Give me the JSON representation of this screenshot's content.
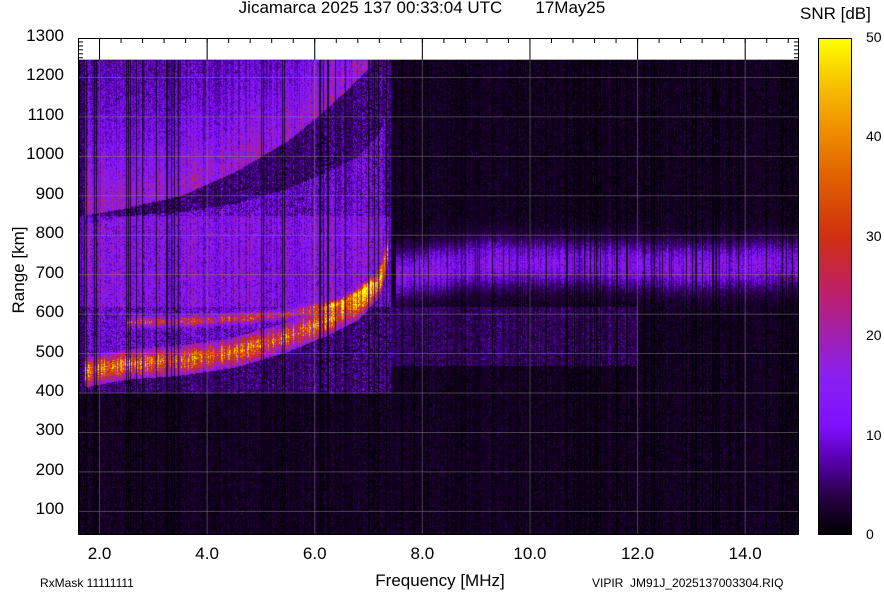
{
  "title": "Jicamarca 2025 137 00:33:04 UTC",
  "date": "17May25",
  "footer": {
    "rxmask": "RxMask 11111111",
    "file": "VIPIR  JM91J_2025137003304.RIQ"
  },
  "chart_data": {
    "type": "heatmap",
    "title": "Jicamarca 2025 137 00:33:04 UTC    17May25",
    "xlabel": "Frequency [MHz]",
    "ylabel": "Range [km]",
    "xlim": [
      1.6,
      15.0
    ],
    "ylim": [
      40,
      1300
    ],
    "xticks": [
      "2.0",
      "4.0",
      "6.0",
      "8.0",
      "10.0",
      "12.0",
      "14.0"
    ],
    "xtick_values": [
      2,
      4,
      6,
      8,
      10,
      12,
      14
    ],
    "yticks": [
      "100",
      "200",
      "300",
      "400",
      "500",
      "600",
      "700",
      "800",
      "900",
      "1000",
      "1100",
      "1200",
      "1300"
    ],
    "ytick_values": [
      100,
      200,
      300,
      400,
      500,
      600,
      700,
      800,
      900,
      1000,
      1100,
      1200,
      1300
    ],
    "grid": true,
    "colorbar": {
      "label": "SNR [dB]",
      "range": [
        0,
        50
      ],
      "ticks": [
        "0",
        "10",
        "20",
        "30",
        "40",
        "50"
      ],
      "tick_values": [
        0,
        10,
        20,
        30,
        40,
        50
      ]
    },
    "data_top_km": 1245,
    "traces": [
      {
        "name": "F-layer trace",
        "snr": 33,
        "width_km": 35,
        "points": [
          [
            1.7,
            450
          ],
          [
            2.5,
            470
          ],
          [
            3.5,
            480
          ],
          [
            4.5,
            500
          ],
          [
            5.5,
            540
          ],
          [
            6.2,
            580
          ],
          [
            6.8,
            620
          ],
          [
            7.2,
            680
          ],
          [
            7.35,
            760
          ]
        ]
      },
      {
        "name": "Upper trace",
        "snr": 24,
        "width_km": 12,
        "points": [
          [
            2.5,
            580
          ],
          [
            4,
            585
          ],
          [
            5.5,
            600
          ],
          [
            6.5,
            630
          ],
          [
            7.1,
            680
          ]
        ]
      },
      {
        "name": "Multi-hop trace",
        "snr": 20,
        "width_km": 60,
        "points": [
          [
            1.7,
            870
          ],
          [
            2.5,
            890
          ],
          [
            3.5,
            920
          ],
          [
            4.5,
            980
          ],
          [
            5.5,
            1060
          ],
          [
            6.3,
            1150
          ],
          [
            7.0,
            1245
          ]
        ]
      },
      {
        "name": "Spread-F band",
        "snr": 15,
        "width_km": 55,
        "points": [
          [
            7.5,
            700
          ],
          [
            9,
            730
          ],
          [
            11,
            730
          ],
          [
            13,
            720
          ],
          [
            15,
            730
          ]
        ]
      }
    ]
  }
}
